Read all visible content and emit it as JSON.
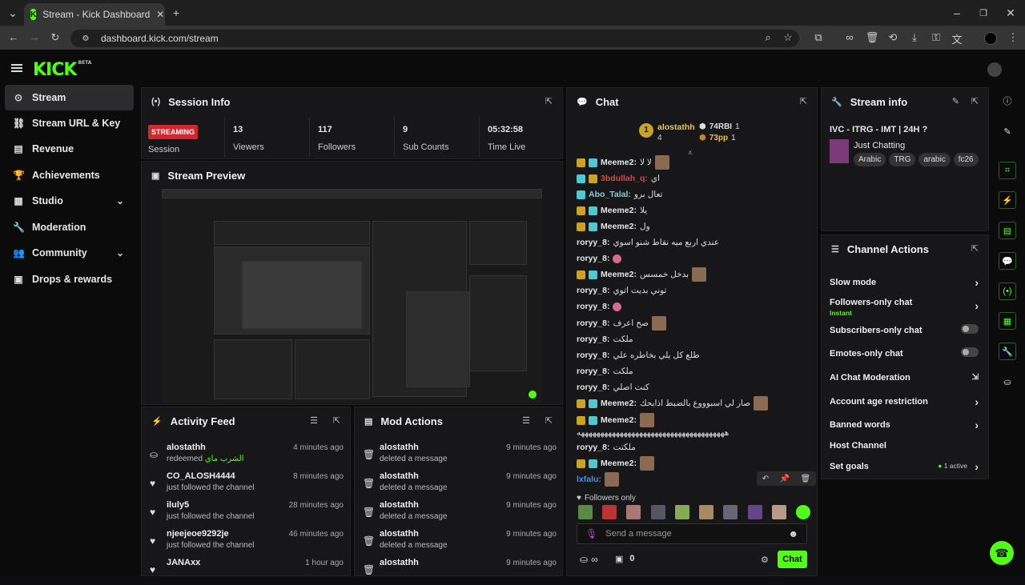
{
  "browser": {
    "tab_title": "Stream - Kick Dashboard",
    "url": "dashboard.kick.com/stream"
  },
  "app": {
    "logo": "KICK",
    "logo_badge": "BETA"
  },
  "sidebar": {
    "items": [
      {
        "label": "Stream",
        "icon": "broadcast-icon"
      },
      {
        "label": "Stream URL & Key",
        "icon": "link-icon"
      },
      {
        "label": "Revenue",
        "icon": "chart-icon"
      },
      {
        "label": "Achievements",
        "icon": "trophy-icon"
      },
      {
        "label": "Studio",
        "icon": "layout-icon"
      },
      {
        "label": "Moderation",
        "icon": "wrench-icon"
      },
      {
        "label": "Community",
        "icon": "people-icon"
      },
      {
        "label": "Drops & rewards",
        "icon": "gift-icon"
      }
    ]
  },
  "session": {
    "title": "Session Info",
    "badge": "STREAMING",
    "session_label": "Session",
    "stats": [
      {
        "value": "13",
        "label": "Viewers"
      },
      {
        "value": "117",
        "label": "Followers"
      },
      {
        "value": "9",
        "label": "Sub Counts"
      },
      {
        "value": "05:32:58",
        "label": "Time Live"
      }
    ]
  },
  "preview": {
    "title": "Stream Preview"
  },
  "activity": {
    "title": "Activity Feed",
    "items": [
      {
        "name": "alostathh",
        "sub": "redeemed",
        "reward": "الشرب ماي",
        "time": "4 minutes ago",
        "icon": "gift-icon"
      },
      {
        "name": "CO_ALOSH4444",
        "sub": "just followed the channel",
        "time": "8 minutes ago",
        "icon": "heart-icon"
      },
      {
        "name": "iluly5",
        "sub": "just followed the channel",
        "time": "28 minutes ago",
        "icon": "heart-icon"
      },
      {
        "name": "njeejeoe9292je",
        "sub": "just followed the channel",
        "time": "46 minutes ago",
        "icon": "heart-icon"
      },
      {
        "name": "JANAxx",
        "sub": "",
        "time": "1 hour ago",
        "icon": "heart-icon"
      }
    ]
  },
  "mod": {
    "title": "Mod Actions",
    "items": [
      {
        "name": "alostathh",
        "sub": "deleted a message",
        "time": "9 minutes ago"
      },
      {
        "name": "alostathh",
        "sub": "deleted a message",
        "time": "9 minutes ago"
      },
      {
        "name": "alostathh",
        "sub": "deleted a message",
        "time": "9 minutes ago"
      },
      {
        "name": "alostathh",
        "sub": "deleted a message",
        "time": "9 minutes ago"
      },
      {
        "name": "alostathh",
        "sub": "",
        "time": "9 minutes ago"
      }
    ]
  },
  "chat": {
    "title": "Chat",
    "leaders": {
      "first": {
        "rank": "1",
        "name": "alostathh",
        "count": "4"
      },
      "second": {
        "name": "74RBI",
        "count": "1"
      },
      "third": {
        "name": "73pp",
        "count": "1"
      }
    },
    "messages": [
      {
        "user": "Meeme2:",
        "text": "لا لا",
        "color": "#e6e6e6"
      },
      {
        "user": "3bdullah_q:",
        "text": "اي",
        "color": "#e0443c"
      },
      {
        "user": "Abo_Talal:",
        "text": "تعال برو",
        "color": "#7fd0d8"
      },
      {
        "user": "Meeme2:",
        "text": "يلا",
        "color": "#e6e6e6"
      },
      {
        "user": "Meeme2:",
        "text": "ول",
        "color": "#e6e6e6"
      },
      {
        "user": "roryy_8:",
        "text": "عندي اربع ميه نقاط شنو اسوي",
        "color": "#e6e6e6"
      },
      {
        "user": "roryy_8:",
        "text": "",
        "color": "#e6e6e6"
      },
      {
        "user": "Meeme2:",
        "text": "بدخل خمسس",
        "color": "#e6e6e6"
      },
      {
        "user": "roryy_8:",
        "text": "توني بديت اتوي",
        "color": "#e6e6e6"
      },
      {
        "user": "roryy_8:",
        "text": "",
        "color": "#e6e6e6"
      },
      {
        "user": "roryy_8:",
        "text": "صح اعرف",
        "color": "#e6e6e6"
      },
      {
        "user": "roryy_8:",
        "text": "ملكت",
        "color": "#e6e6e6"
      },
      {
        "user": "roryy_8:",
        "text": "طلع كل يلي بخاطره علي",
        "color": "#e6e6e6"
      },
      {
        "user": "roryy_8:",
        "text": "ملكت",
        "color": "#e6e6e6"
      },
      {
        "user": "roryy_8:",
        "text": "كنت اصلي",
        "color": "#e6e6e6"
      },
      {
        "user": "Meeme2:",
        "text": "صار لي اسبوووع بالضبط اذابحك",
        "color": "#e6e6e6"
      },
      {
        "user": "Meeme2:",
        "text": "",
        "color": "#e6e6e6"
      },
      {
        "user": "",
        "text": "ههههههههههههههههههههههههههههههههههههههه",
        "color": "#e6e6e6"
      },
      {
        "user": "roryy_8:",
        "text": "ملكتت",
        "color": "#e6e6e6"
      },
      {
        "user": "Meeme2:",
        "text": "",
        "color": "#e6e6e6"
      },
      {
        "user": "lxfalu:",
        "text": "",
        "color": "#4b8ef0"
      }
    ],
    "followers_only": "Followers only",
    "placeholder": "Send a message",
    "infinity": "∞",
    "gift_count": "0",
    "send_label": "Chat"
  },
  "stream_info": {
    "title": "Stream info",
    "stream_title": "IVC - ITRG - IMT | 24H ?",
    "category": "Just Chatting",
    "tags": [
      "Arabic",
      "TRG",
      "arabic",
      "fc26"
    ]
  },
  "channel_actions": {
    "title": "Channel Actions",
    "items": [
      {
        "label": "Slow mode",
        "control": "arrow"
      },
      {
        "label": "Followers-only chat",
        "sub": "Instant",
        "control": "arrow"
      },
      {
        "label": "Subscribers-only chat",
        "control": "toggle"
      },
      {
        "label": "Emotes-only chat",
        "control": "toggle"
      },
      {
        "label": "AI Chat Moderation",
        "control": "external"
      },
      {
        "label": "Account age restriction",
        "control": "arrow"
      },
      {
        "label": "Banned words",
        "control": "arrow"
      },
      {
        "label": "Host Channel",
        "control": "none"
      },
      {
        "label": "Set goals",
        "badge": "1 active",
        "control": "arrow"
      }
    ]
  },
  "colors": {
    "accent": "#53fc18",
    "streaming": "#d3262e"
  }
}
